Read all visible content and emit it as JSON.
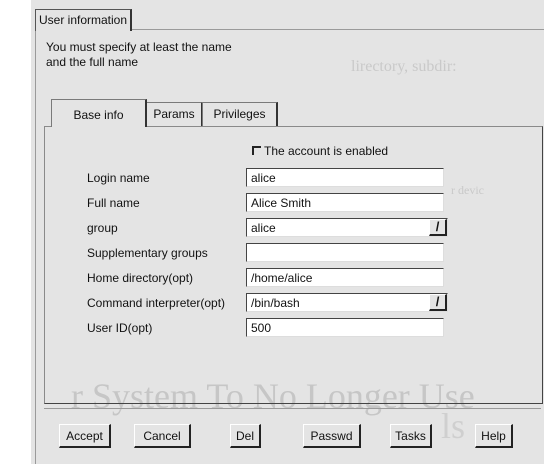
{
  "window": {
    "tab_label": "User information"
  },
  "intro": {
    "line1": "You must specify at least the name",
    "line2": "and the full name"
  },
  "tabs": [
    {
      "label": "Base info",
      "active": true
    },
    {
      "label": "Params",
      "active": false
    },
    {
      "label": "Privileges",
      "active": false
    }
  ],
  "enabled_checkbox": {
    "label": "The account is enabled",
    "checked": true
  },
  "form": {
    "login_name": {
      "label": "Login name",
      "value": "alice"
    },
    "full_name": {
      "label": "Full name",
      "value": "Alice Smith"
    },
    "group": {
      "label": "group",
      "value": "alice"
    },
    "supp_groups": {
      "label": "Supplementary groups",
      "value": ""
    },
    "home_dir": {
      "label": "Home directory(opt)",
      "value": "/home/alice"
    },
    "shell": {
      "label": "Command interpreter(opt)",
      "value": "/bin/bash"
    },
    "user_id": {
      "label": "User ID(opt)",
      "value": "500"
    }
  },
  "buttons": {
    "accept": "Accept",
    "cancel": "Cancel",
    "del": "Del",
    "passwd": "Passwd",
    "tasks": "Tasks",
    "help": "Help"
  },
  "background": {
    "text1": "lirectory, subdir:",
    "text2": "r devic",
    "text3": "r System To No Longer Use",
    "text4": "ls"
  },
  "icons": {
    "dropdown": "dropdown-arrow-icon",
    "checkbox": "checkbox-checked-icon"
  }
}
